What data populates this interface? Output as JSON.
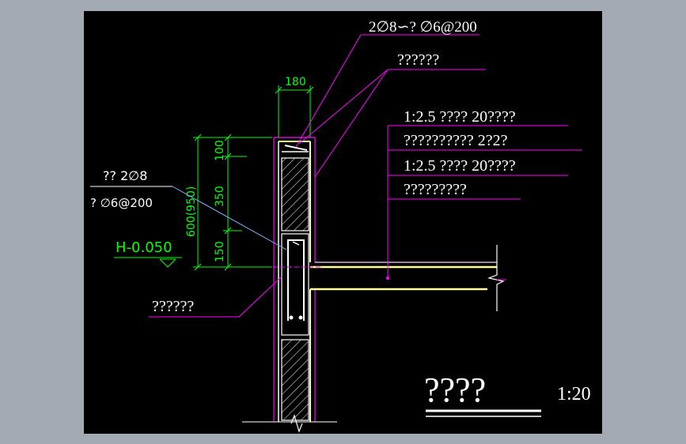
{
  "drawing": {
    "colors": {
      "background": "#000000",
      "border": "#a3aab3",
      "leader": "#ff00ff",
      "dimension": "#00ff00",
      "wall": "#ffffff",
      "finish": "#ffff99",
      "hatch": "#ffffff",
      "rebar": "#00ffff"
    },
    "labels": {
      "rebar_top": "2∅8∽? ∅6@200",
      "note_top": "??????",
      "dim_180": "180",
      "layer1": "1:2.5 ????   20????",
      "layer2": "??????????    2?2?",
      "layer3": "1:2.5 ????  20????",
      "layer4": "?????????",
      "left_note1": "?? 2∅8",
      "left_note2": "? ∅6@200",
      "dim_600": "600(950)",
      "dim_100": "100",
      "dim_350": "350",
      "dim_150": "150",
      "elevation": "H-0.050",
      "bottom_note": "??????",
      "title": "????",
      "scale": "1:20"
    }
  }
}
